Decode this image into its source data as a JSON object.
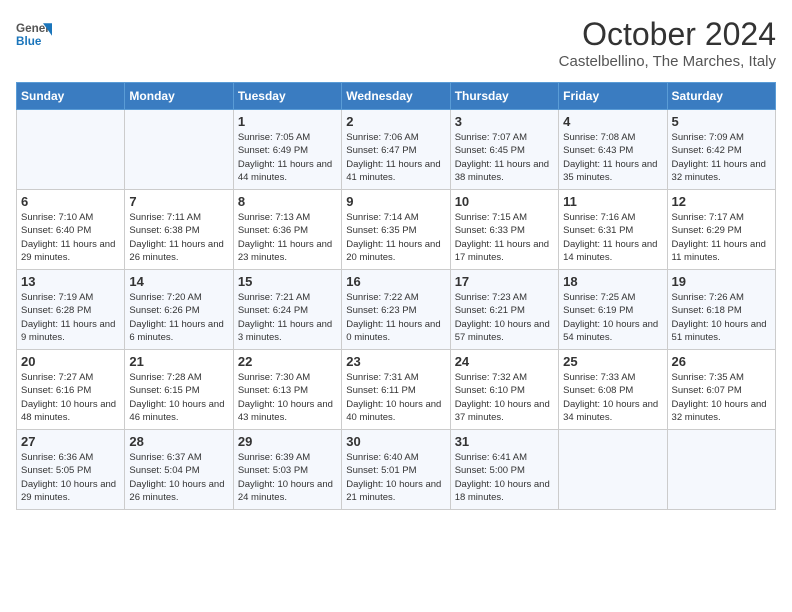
{
  "header": {
    "logo_general": "General",
    "logo_blue": "Blue",
    "month_title": "October 2024",
    "location": "Castelbellino, The Marches, Italy"
  },
  "days_of_week": [
    "Sunday",
    "Monday",
    "Tuesday",
    "Wednesday",
    "Thursday",
    "Friday",
    "Saturday"
  ],
  "weeks": [
    [
      {
        "day": "",
        "sunrise": "",
        "sunset": "",
        "daylight": ""
      },
      {
        "day": "",
        "sunrise": "",
        "sunset": "",
        "daylight": ""
      },
      {
        "day": "1",
        "sunrise": "Sunrise: 7:05 AM",
        "sunset": "Sunset: 6:49 PM",
        "daylight": "Daylight: 11 hours and 44 minutes."
      },
      {
        "day": "2",
        "sunrise": "Sunrise: 7:06 AM",
        "sunset": "Sunset: 6:47 PM",
        "daylight": "Daylight: 11 hours and 41 minutes."
      },
      {
        "day": "3",
        "sunrise": "Sunrise: 7:07 AM",
        "sunset": "Sunset: 6:45 PM",
        "daylight": "Daylight: 11 hours and 38 minutes."
      },
      {
        "day": "4",
        "sunrise": "Sunrise: 7:08 AM",
        "sunset": "Sunset: 6:43 PM",
        "daylight": "Daylight: 11 hours and 35 minutes."
      },
      {
        "day": "5",
        "sunrise": "Sunrise: 7:09 AM",
        "sunset": "Sunset: 6:42 PM",
        "daylight": "Daylight: 11 hours and 32 minutes."
      }
    ],
    [
      {
        "day": "6",
        "sunrise": "Sunrise: 7:10 AM",
        "sunset": "Sunset: 6:40 PM",
        "daylight": "Daylight: 11 hours and 29 minutes."
      },
      {
        "day": "7",
        "sunrise": "Sunrise: 7:11 AM",
        "sunset": "Sunset: 6:38 PM",
        "daylight": "Daylight: 11 hours and 26 minutes."
      },
      {
        "day": "8",
        "sunrise": "Sunrise: 7:13 AM",
        "sunset": "Sunset: 6:36 PM",
        "daylight": "Daylight: 11 hours and 23 minutes."
      },
      {
        "day": "9",
        "sunrise": "Sunrise: 7:14 AM",
        "sunset": "Sunset: 6:35 PM",
        "daylight": "Daylight: 11 hours and 20 minutes."
      },
      {
        "day": "10",
        "sunrise": "Sunrise: 7:15 AM",
        "sunset": "Sunset: 6:33 PM",
        "daylight": "Daylight: 11 hours and 17 minutes."
      },
      {
        "day": "11",
        "sunrise": "Sunrise: 7:16 AM",
        "sunset": "Sunset: 6:31 PM",
        "daylight": "Daylight: 11 hours and 14 minutes."
      },
      {
        "day": "12",
        "sunrise": "Sunrise: 7:17 AM",
        "sunset": "Sunset: 6:29 PM",
        "daylight": "Daylight: 11 hours and 11 minutes."
      }
    ],
    [
      {
        "day": "13",
        "sunrise": "Sunrise: 7:19 AM",
        "sunset": "Sunset: 6:28 PM",
        "daylight": "Daylight: 11 hours and 9 minutes."
      },
      {
        "day": "14",
        "sunrise": "Sunrise: 7:20 AM",
        "sunset": "Sunset: 6:26 PM",
        "daylight": "Daylight: 11 hours and 6 minutes."
      },
      {
        "day": "15",
        "sunrise": "Sunrise: 7:21 AM",
        "sunset": "Sunset: 6:24 PM",
        "daylight": "Daylight: 11 hours and 3 minutes."
      },
      {
        "day": "16",
        "sunrise": "Sunrise: 7:22 AM",
        "sunset": "Sunset: 6:23 PM",
        "daylight": "Daylight: 11 hours and 0 minutes."
      },
      {
        "day": "17",
        "sunrise": "Sunrise: 7:23 AM",
        "sunset": "Sunset: 6:21 PM",
        "daylight": "Daylight: 10 hours and 57 minutes."
      },
      {
        "day": "18",
        "sunrise": "Sunrise: 7:25 AM",
        "sunset": "Sunset: 6:19 PM",
        "daylight": "Daylight: 10 hours and 54 minutes."
      },
      {
        "day": "19",
        "sunrise": "Sunrise: 7:26 AM",
        "sunset": "Sunset: 6:18 PM",
        "daylight": "Daylight: 10 hours and 51 minutes."
      }
    ],
    [
      {
        "day": "20",
        "sunrise": "Sunrise: 7:27 AM",
        "sunset": "Sunset: 6:16 PM",
        "daylight": "Daylight: 10 hours and 48 minutes."
      },
      {
        "day": "21",
        "sunrise": "Sunrise: 7:28 AM",
        "sunset": "Sunset: 6:15 PM",
        "daylight": "Daylight: 10 hours and 46 minutes."
      },
      {
        "day": "22",
        "sunrise": "Sunrise: 7:30 AM",
        "sunset": "Sunset: 6:13 PM",
        "daylight": "Daylight: 10 hours and 43 minutes."
      },
      {
        "day": "23",
        "sunrise": "Sunrise: 7:31 AM",
        "sunset": "Sunset: 6:11 PM",
        "daylight": "Daylight: 10 hours and 40 minutes."
      },
      {
        "day": "24",
        "sunrise": "Sunrise: 7:32 AM",
        "sunset": "Sunset: 6:10 PM",
        "daylight": "Daylight: 10 hours and 37 minutes."
      },
      {
        "day": "25",
        "sunrise": "Sunrise: 7:33 AM",
        "sunset": "Sunset: 6:08 PM",
        "daylight": "Daylight: 10 hours and 34 minutes."
      },
      {
        "day": "26",
        "sunrise": "Sunrise: 7:35 AM",
        "sunset": "Sunset: 6:07 PM",
        "daylight": "Daylight: 10 hours and 32 minutes."
      }
    ],
    [
      {
        "day": "27",
        "sunrise": "Sunrise: 6:36 AM",
        "sunset": "Sunset: 5:05 PM",
        "daylight": "Daylight: 10 hours and 29 minutes."
      },
      {
        "day": "28",
        "sunrise": "Sunrise: 6:37 AM",
        "sunset": "Sunset: 5:04 PM",
        "daylight": "Daylight: 10 hours and 26 minutes."
      },
      {
        "day": "29",
        "sunrise": "Sunrise: 6:39 AM",
        "sunset": "Sunset: 5:03 PM",
        "daylight": "Daylight: 10 hours and 24 minutes."
      },
      {
        "day": "30",
        "sunrise": "Sunrise: 6:40 AM",
        "sunset": "Sunset: 5:01 PM",
        "daylight": "Daylight: 10 hours and 21 minutes."
      },
      {
        "day": "31",
        "sunrise": "Sunrise: 6:41 AM",
        "sunset": "Sunset: 5:00 PM",
        "daylight": "Daylight: 10 hours and 18 minutes."
      },
      {
        "day": "",
        "sunrise": "",
        "sunset": "",
        "daylight": ""
      },
      {
        "day": "",
        "sunrise": "",
        "sunset": "",
        "daylight": ""
      }
    ]
  ]
}
